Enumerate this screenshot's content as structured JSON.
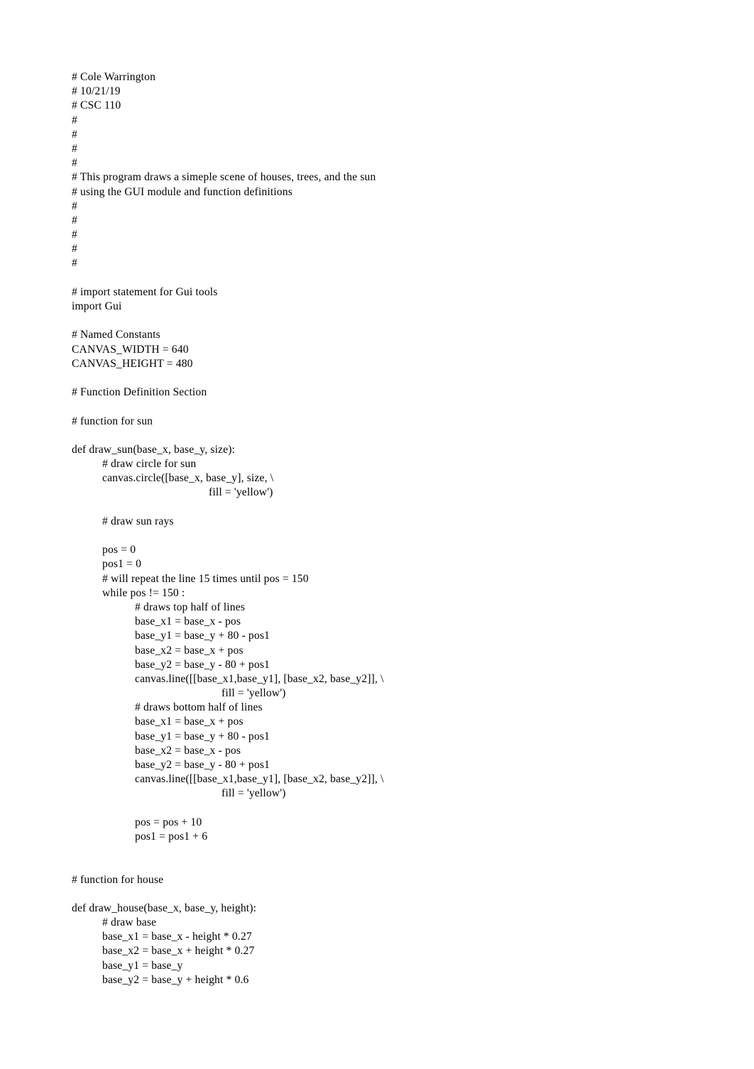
{
  "document": {
    "type": "python-source-listing",
    "background_color": "#ffffff",
    "text_color": "#000000",
    "author_comment": "# Cole Warrington",
    "date_comment": "# 10/21/19",
    "course_comment": "# CSC 110"
  },
  "code": {
    "lines": [
      {
        "indent": "i0",
        "text": "# Cole Warrington"
      },
      {
        "indent": "i0",
        "text": "# 10/21/19"
      },
      {
        "indent": "i0",
        "text": "# CSC 110"
      },
      {
        "indent": "i0",
        "text": "#"
      },
      {
        "indent": "i0",
        "text": "#"
      },
      {
        "indent": "i0",
        "text": "#"
      },
      {
        "indent": "i0",
        "text": "#"
      },
      {
        "indent": "i0",
        "text": "# This program draws a simeple scene of houses, trees, and the sun"
      },
      {
        "indent": "i0",
        "text": "# using the GUI module and function definitions"
      },
      {
        "indent": "i0",
        "text": "#"
      },
      {
        "indent": "i0",
        "text": "#"
      },
      {
        "indent": "i0",
        "text": "#"
      },
      {
        "indent": "i0",
        "text": "#"
      },
      {
        "indent": "i0",
        "text": "#"
      },
      {
        "indent": "i0",
        "text": ""
      },
      {
        "indent": "i0",
        "text": "# import statement for Gui tools"
      },
      {
        "indent": "i0",
        "text": "import Gui"
      },
      {
        "indent": "i0",
        "text": ""
      },
      {
        "indent": "i0",
        "text": "# Named Constants"
      },
      {
        "indent": "i0",
        "text": "CANVAS_WIDTH = 640"
      },
      {
        "indent": "i0",
        "text": "CANVAS_HEIGHT = 480"
      },
      {
        "indent": "i0",
        "text": ""
      },
      {
        "indent": "i0",
        "text": "# Function Definition Section"
      },
      {
        "indent": "i0",
        "text": ""
      },
      {
        "indent": "i0",
        "text": "# function for sun"
      },
      {
        "indent": "i0",
        "text": ""
      },
      {
        "indent": "i0",
        "text": "def draw_sun(base_x, base_y, size):"
      },
      {
        "indent": "i1",
        "text": "# draw circle for sun"
      },
      {
        "indent": "i1",
        "text": "canvas.circle([base_x, base_y], size, \\"
      },
      {
        "indent": "i-cont1",
        "text": "fill = 'yellow')"
      },
      {
        "indent": "i0",
        "text": ""
      },
      {
        "indent": "i1",
        "text": "# draw sun rays"
      },
      {
        "indent": "i0",
        "text": ""
      },
      {
        "indent": "i1",
        "text": "pos = 0"
      },
      {
        "indent": "i1",
        "text": "pos1 = 0"
      },
      {
        "indent": "i1",
        "text": "# will repeat the line 15 times until pos = 150"
      },
      {
        "indent": "i1",
        "text": "while pos != 150 :"
      },
      {
        "indent": "i2",
        "text": "# draws top half of lines"
      },
      {
        "indent": "i2",
        "text": "base_x1 = base_x - pos"
      },
      {
        "indent": "i2",
        "text": "base_y1 = base_y + 80 - pos1"
      },
      {
        "indent": "i2",
        "text": "base_x2 = base_x + pos"
      },
      {
        "indent": "i2",
        "text": "base_y2 = base_y - 80 + pos1"
      },
      {
        "indent": "i2",
        "text": "canvas.line([[base_x1,base_y1], [base_x2, base_y2]], \\"
      },
      {
        "indent": "i-cont2",
        "text": "fill = 'yellow')"
      },
      {
        "indent": "i2",
        "text": "# draws bottom half of lines"
      },
      {
        "indent": "i2",
        "text": "base_x1 = base_x + pos"
      },
      {
        "indent": "i2",
        "text": "base_y1 = base_y + 80 - pos1"
      },
      {
        "indent": "i2",
        "text": "base_x2 = base_x - pos"
      },
      {
        "indent": "i2",
        "text": "base_y2 = base_y - 80 + pos1"
      },
      {
        "indent": "i2",
        "text": "canvas.line([[base_x1,base_y1], [base_x2, base_y2]], \\"
      },
      {
        "indent": "i-cont2",
        "text": "fill = 'yellow')"
      },
      {
        "indent": "i0",
        "text": ""
      },
      {
        "indent": "i2",
        "text": "pos = pos + 10"
      },
      {
        "indent": "i2",
        "text": "pos1 = pos1 + 6"
      },
      {
        "indent": "i0",
        "text": ""
      },
      {
        "indent": "i0",
        "text": ""
      },
      {
        "indent": "i0",
        "text": "# function for house"
      },
      {
        "indent": "i0",
        "text": ""
      },
      {
        "indent": "i0",
        "text": "def draw_house(base_x, base_y, height):"
      },
      {
        "indent": "i1",
        "text": "# draw base"
      },
      {
        "indent": "i1",
        "text": "base_x1 = base_x - height * 0.27"
      },
      {
        "indent": "i1",
        "text": "base_x2 = base_x + height * 0.27"
      },
      {
        "indent": "i1",
        "text": "base_y1 = base_y"
      },
      {
        "indent": "i1",
        "text": "base_y2 = base_y + height * 0.6"
      }
    ]
  }
}
